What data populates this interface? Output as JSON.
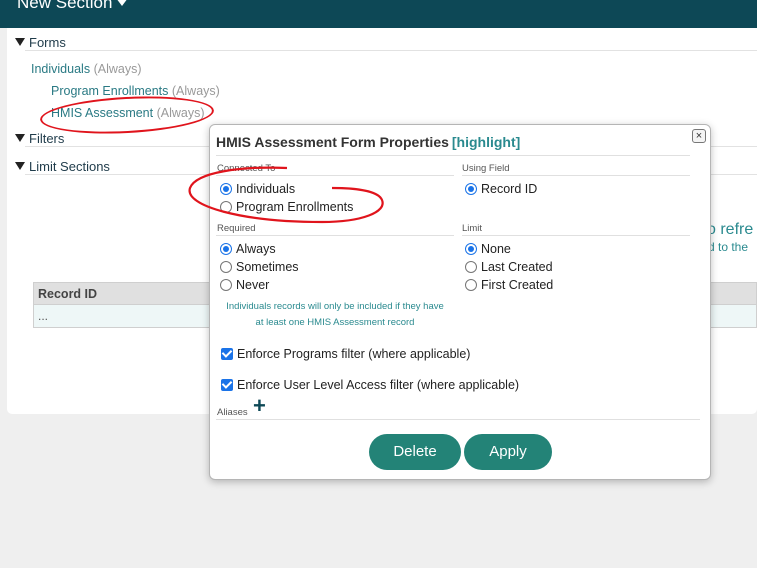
{
  "header": {
    "title": "New Section"
  },
  "sections": {
    "forms": "Forms",
    "filters": "Filters",
    "limit_sections": "Limit Sections"
  },
  "tree": {
    "individuals": {
      "label": "Individuals",
      "suffix": "(Always)"
    },
    "program_enrollments": {
      "label": "Program Enrollments",
      "suffix": "(Always)"
    },
    "hmis_assessment": {
      "label": "HMIS Assessment",
      "suffix": "(Always)"
    }
  },
  "background": {
    "refresh_fragment": "o refre",
    "added_fragment": "d to the"
  },
  "grid": {
    "column_header": "Record ID",
    "row_value": "..."
  },
  "dialog": {
    "title": "HMIS Assessment Form Properties",
    "highlight": "[highlight]",
    "close": "×",
    "connected_to_label": "Connected To",
    "connected_to_options": [
      "Individuals",
      "Program Enrollments"
    ],
    "connected_to_selected": 0,
    "using_field_label": "Using Field",
    "using_field_options": [
      "Record ID"
    ],
    "required_label": "Required",
    "required_options": [
      "Always",
      "Sometimes",
      "Never"
    ],
    "required_selected": 0,
    "limit_label": "Limit",
    "limit_options": [
      "None",
      "Last Created",
      "First Created"
    ],
    "limit_selected": 0,
    "note_line1": "Individuals records will only be included if they have",
    "note_line2": "at least one HMIS Assessment record",
    "enforce_programs": "Enforce Programs filter (where applicable)",
    "enforce_user_level": "Enforce User Level Access filter (where applicable)",
    "aliases_label": "Aliases",
    "add_alias": "+",
    "delete_button": "Delete",
    "apply_button": "Apply"
  },
  "colors": {
    "header_bg": "#0d4856",
    "accent_teal": "#2a8a8f",
    "button_green": "#238377",
    "annotation_red": "#e0141c",
    "control_blue": "#1a73e8"
  }
}
